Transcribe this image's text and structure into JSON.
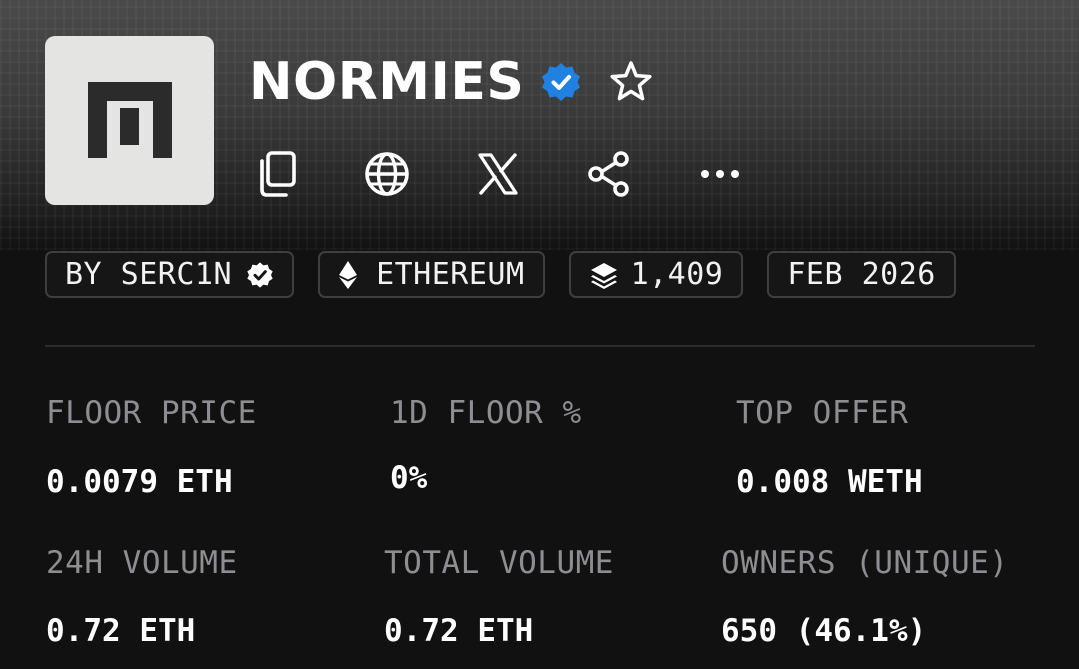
{
  "collection": {
    "name": "NORMIES",
    "verified": true,
    "brand_color": "#2081e2"
  },
  "action_icons": [
    "copy-icon",
    "globe-icon",
    "x-logo-icon",
    "share-icon",
    "more-icon"
  ],
  "badges": {
    "creator": "BY SERC1N",
    "chain": "ETHEREUM",
    "items": "1,409",
    "date": "FEB 2026"
  },
  "stats": {
    "floor_price": {
      "label": "FLOOR PRICE",
      "value": "0.0079 ETH"
    },
    "floor_change_1d": {
      "label": "1D FLOOR %",
      "value": "0%"
    },
    "top_offer": {
      "label": "TOP OFFER",
      "value": "0.008 WETH"
    },
    "volume_24h": {
      "label": "24H VOLUME",
      "value": "0.72 ETH"
    },
    "total_volume": {
      "label": "TOTAL VOLUME",
      "value": "0.72 ETH"
    },
    "owners": {
      "label": "OWNERS (UNIQUE)",
      "value": "650 (46.1%)"
    }
  }
}
